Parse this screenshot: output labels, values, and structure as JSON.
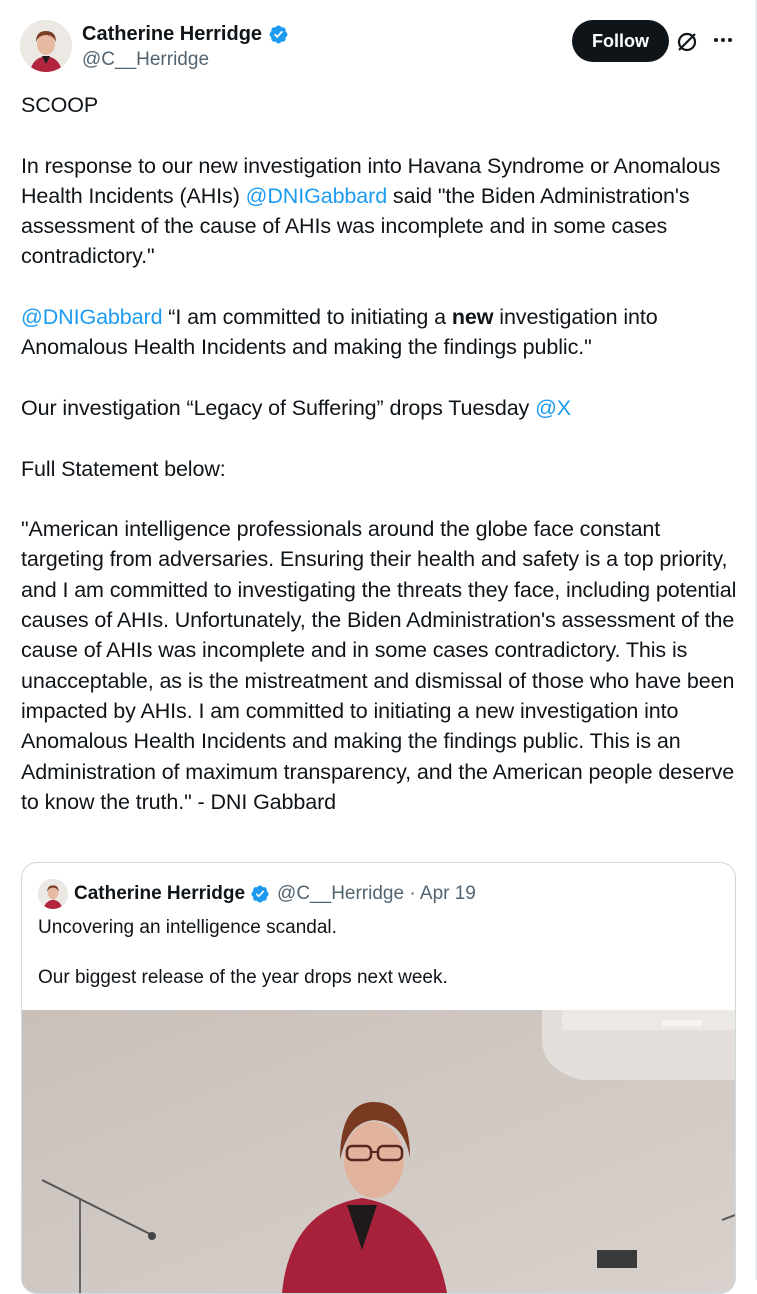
{
  "author": {
    "name": "Catherine Herridge",
    "handle": "@C__Herridge",
    "verified": true
  },
  "actions": {
    "follow_label": "Follow",
    "grok_icon": "grok-icon",
    "more_icon": "more-icon"
  },
  "tweet": {
    "p1": "SCOOP",
    "p2_a": "In response to our new investigation into Havana Syndrome or Anomalous Health Incidents (AHIs) ",
    "p2_mention": "@DNIGabbard",
    "p2_b": " said \"the Biden Administration's assessment of the cause of AHIs was incomplete and in some cases contradictory.\"",
    "p3_mention": "@DNIGabbard",
    "p3_a": " “I am committed to initiating a ",
    "p3_bold": "new",
    "p3_b": " investigation into Anomalous Health Incidents and making the findings public.\"",
    "p4_a": "Our investigation “Legacy of Suffering” drops Tuesday ",
    "p4_mention": "@X",
    "p5": "Full Statement below:",
    "p6": "\"American intelligence professionals around the globe face constant targeting from adversaries. Ensuring their health and safety is a top priority, and I am committed to investigating the threats they face, including potential causes of AHIs. Unfortunately, the Biden Administration's assessment of the cause of AHIs was incomplete and in some cases contradictory. This is unacceptable, as is the mistreatment and dismissal of those who have been impacted by AHIs. I am committed to initiating a new investigation into Anomalous Health Incidents and making the findings public. This is an Administration of maximum transparency, and the American people deserve to know the truth.\" - DNI Gabbard"
  },
  "quote": {
    "name": "Catherine Herridge",
    "handle_date": "@C__Herridge · Apr 19",
    "line1": "Uncovering an intelligence scandal.",
    "line2": "Our biggest release of the year drops next week."
  },
  "colors": {
    "accent": "#1d9bf0",
    "text": "#0f1419",
    "muted": "#536471",
    "follow_bg": "#0f1419"
  }
}
